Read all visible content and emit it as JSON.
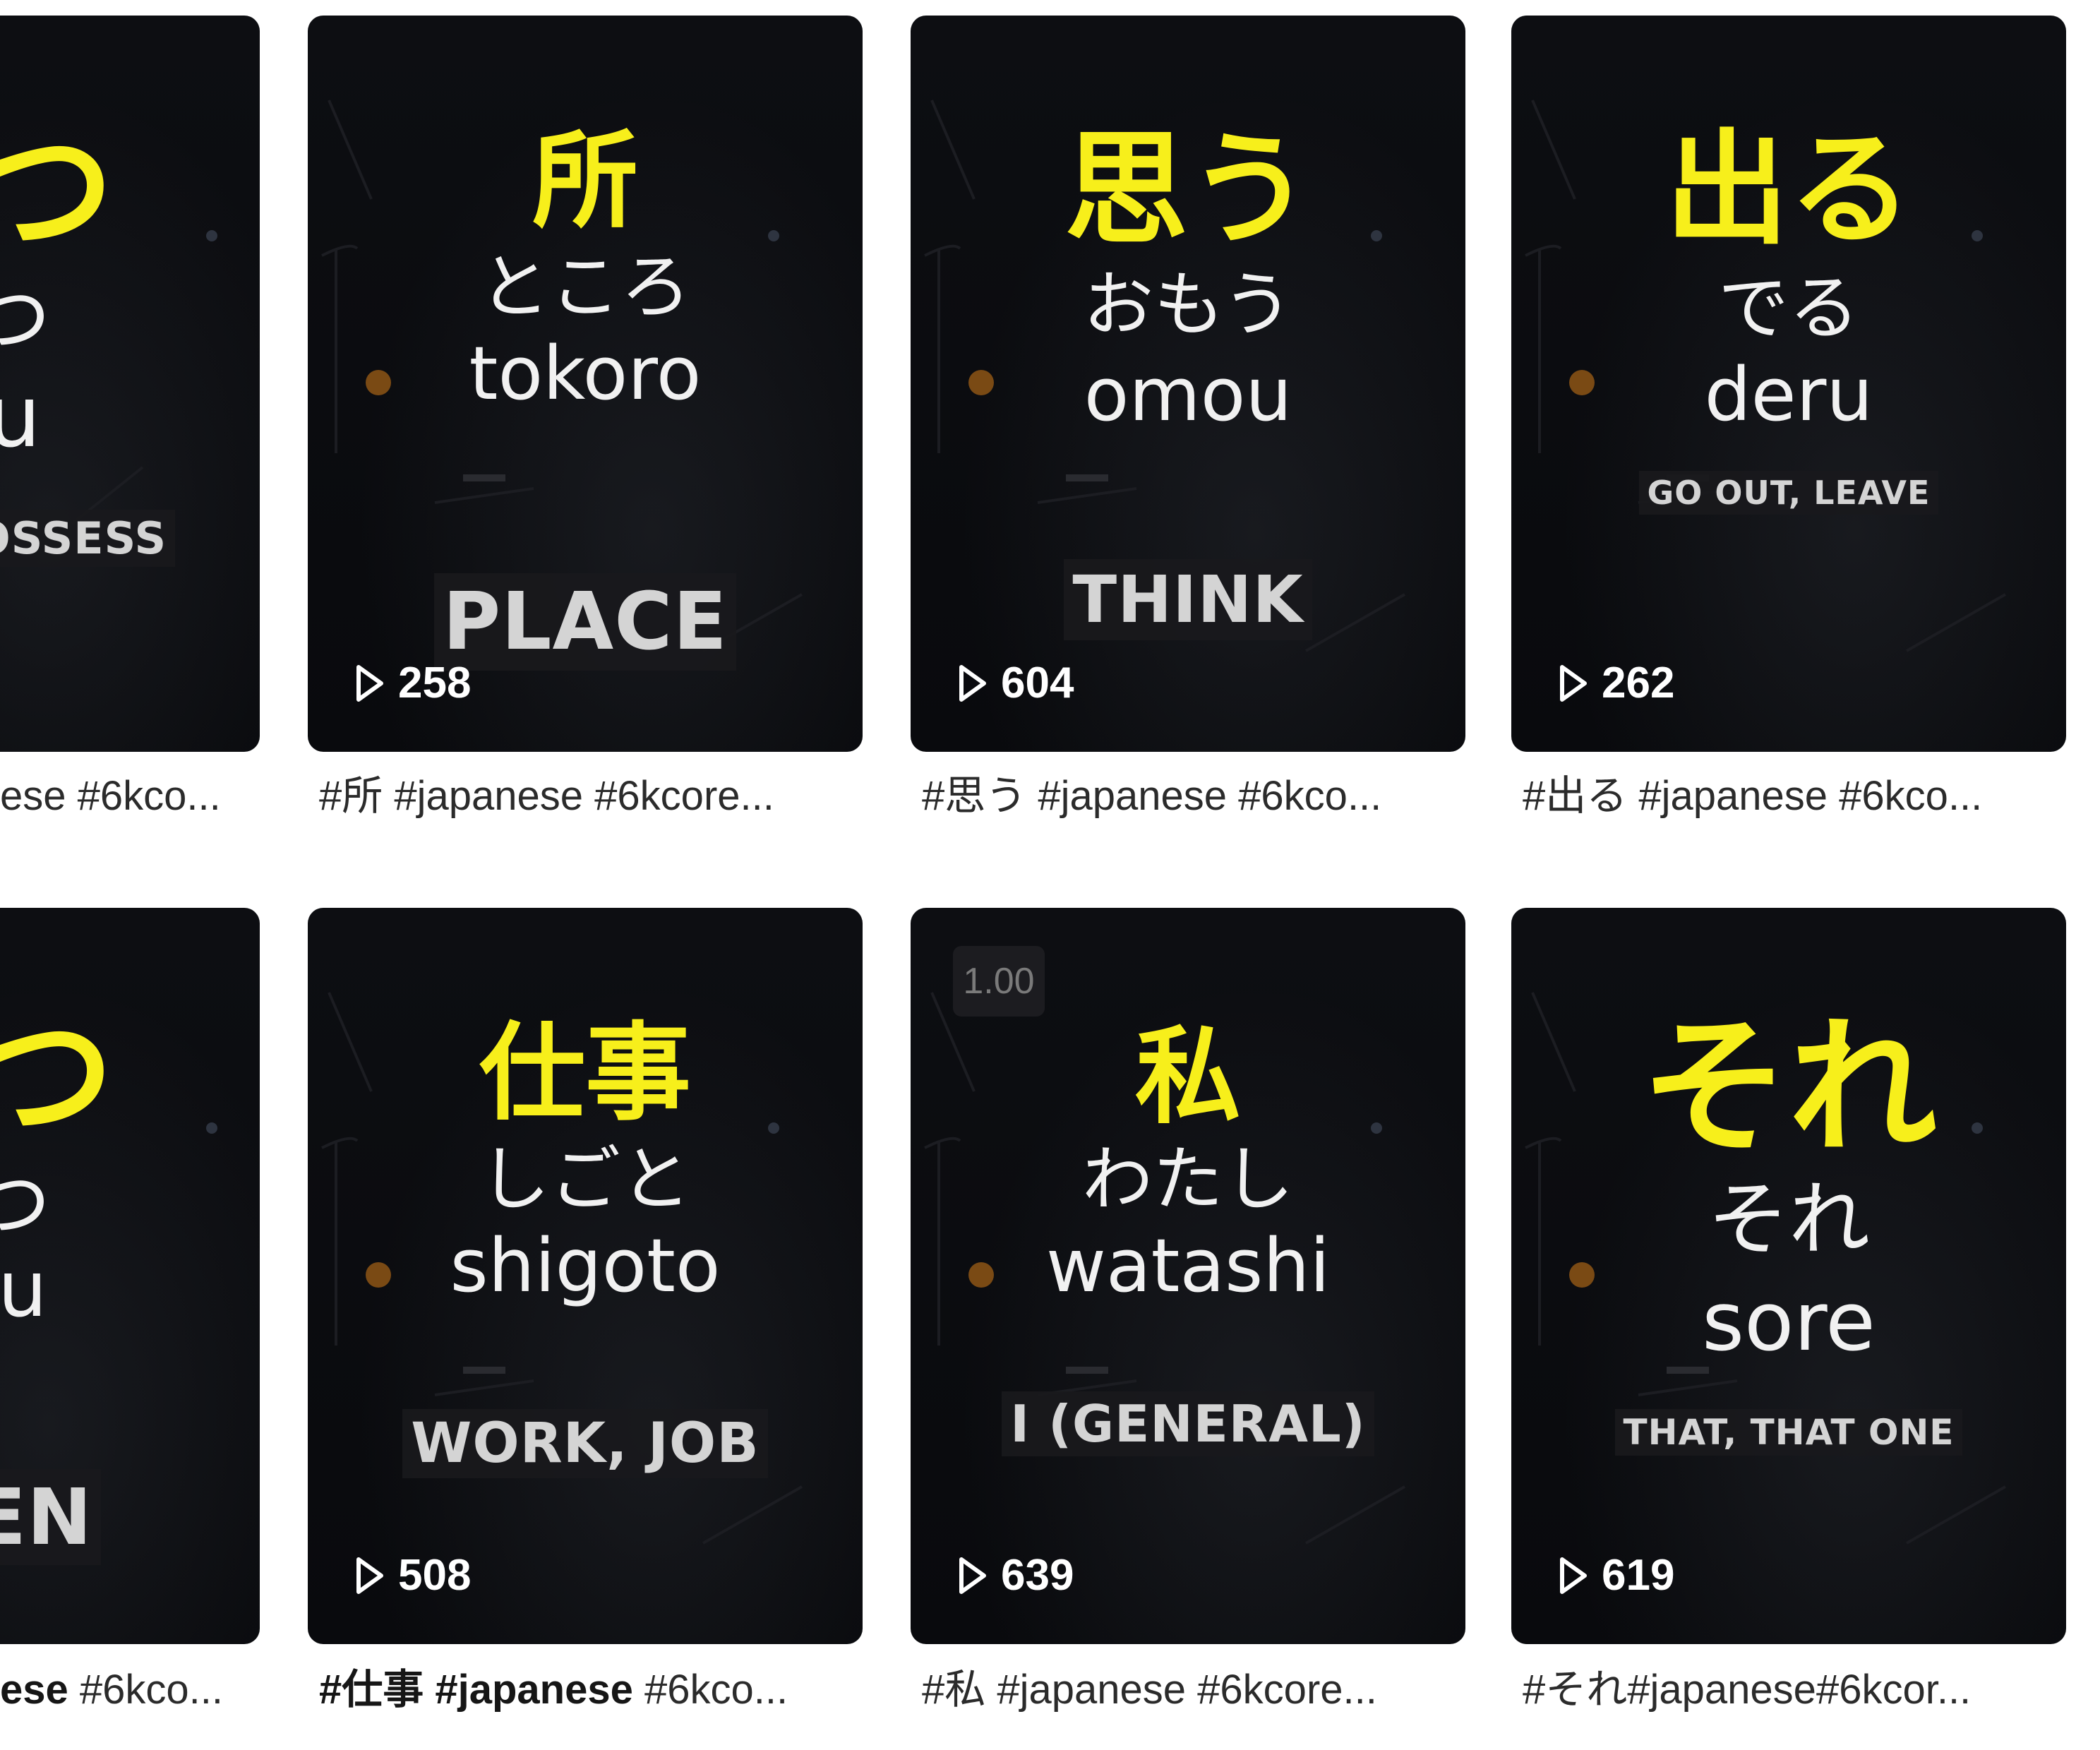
{
  "cards": [
    {
      "kanji": "つ",
      "kana": "つ",
      "romaji": "tsu",
      "meaning": "OSSESS",
      "caption": "ese #6kco..."
    },
    {
      "kanji": "所",
      "kana": "ところ",
      "romaji": "tokoro",
      "meaning": "PLACE",
      "views": "258",
      "caption": "#所 #japanese #6kcore..."
    },
    {
      "kanji": "思う",
      "kana": "おもう",
      "romaji": "omou",
      "meaning": "THINK",
      "views": "604",
      "caption": "#思う #japanese #6kco..."
    },
    {
      "kanji": "出る",
      "kana": "でる",
      "romaji": "deru",
      "meaning": "GO OUT, LEAVE",
      "views": "262",
      "caption": "#出る #japanese #6kco..."
    },
    {
      "kanji": "つ",
      "kana": "つ",
      "romaji": "u",
      "meaning": "EN",
      "caption_bold": "ese",
      "caption_rest": " #6kco..."
    },
    {
      "kanji": "仕事",
      "kana": "しごと",
      "romaji": "shigoto",
      "meaning": "WORK, JOB",
      "views": "508",
      "caption_bold": "#仕事 #japanese",
      "caption_rest": " #6kco..."
    },
    {
      "kanji": "私",
      "kana": "わたし",
      "romaji": "watashi",
      "meaning": "I (GENERAL)",
      "views": "639",
      "speed": "1.00",
      "caption": "#私 #japanese #6kcore..."
    },
    {
      "kanji": "それ",
      "kana": "それ",
      "romaji": "sore",
      "meaning": "THAT, THAT ONE",
      "views": "619",
      "caption": "#それ#japanese#6kcor..."
    }
  ],
  "icons": {
    "views": "play-icon"
  },
  "colors": {
    "kanji": "#f7ef1b",
    "card_bg": "#0b0c0f",
    "text": "#f1f1f1",
    "caption": "#2b2b2b"
  }
}
